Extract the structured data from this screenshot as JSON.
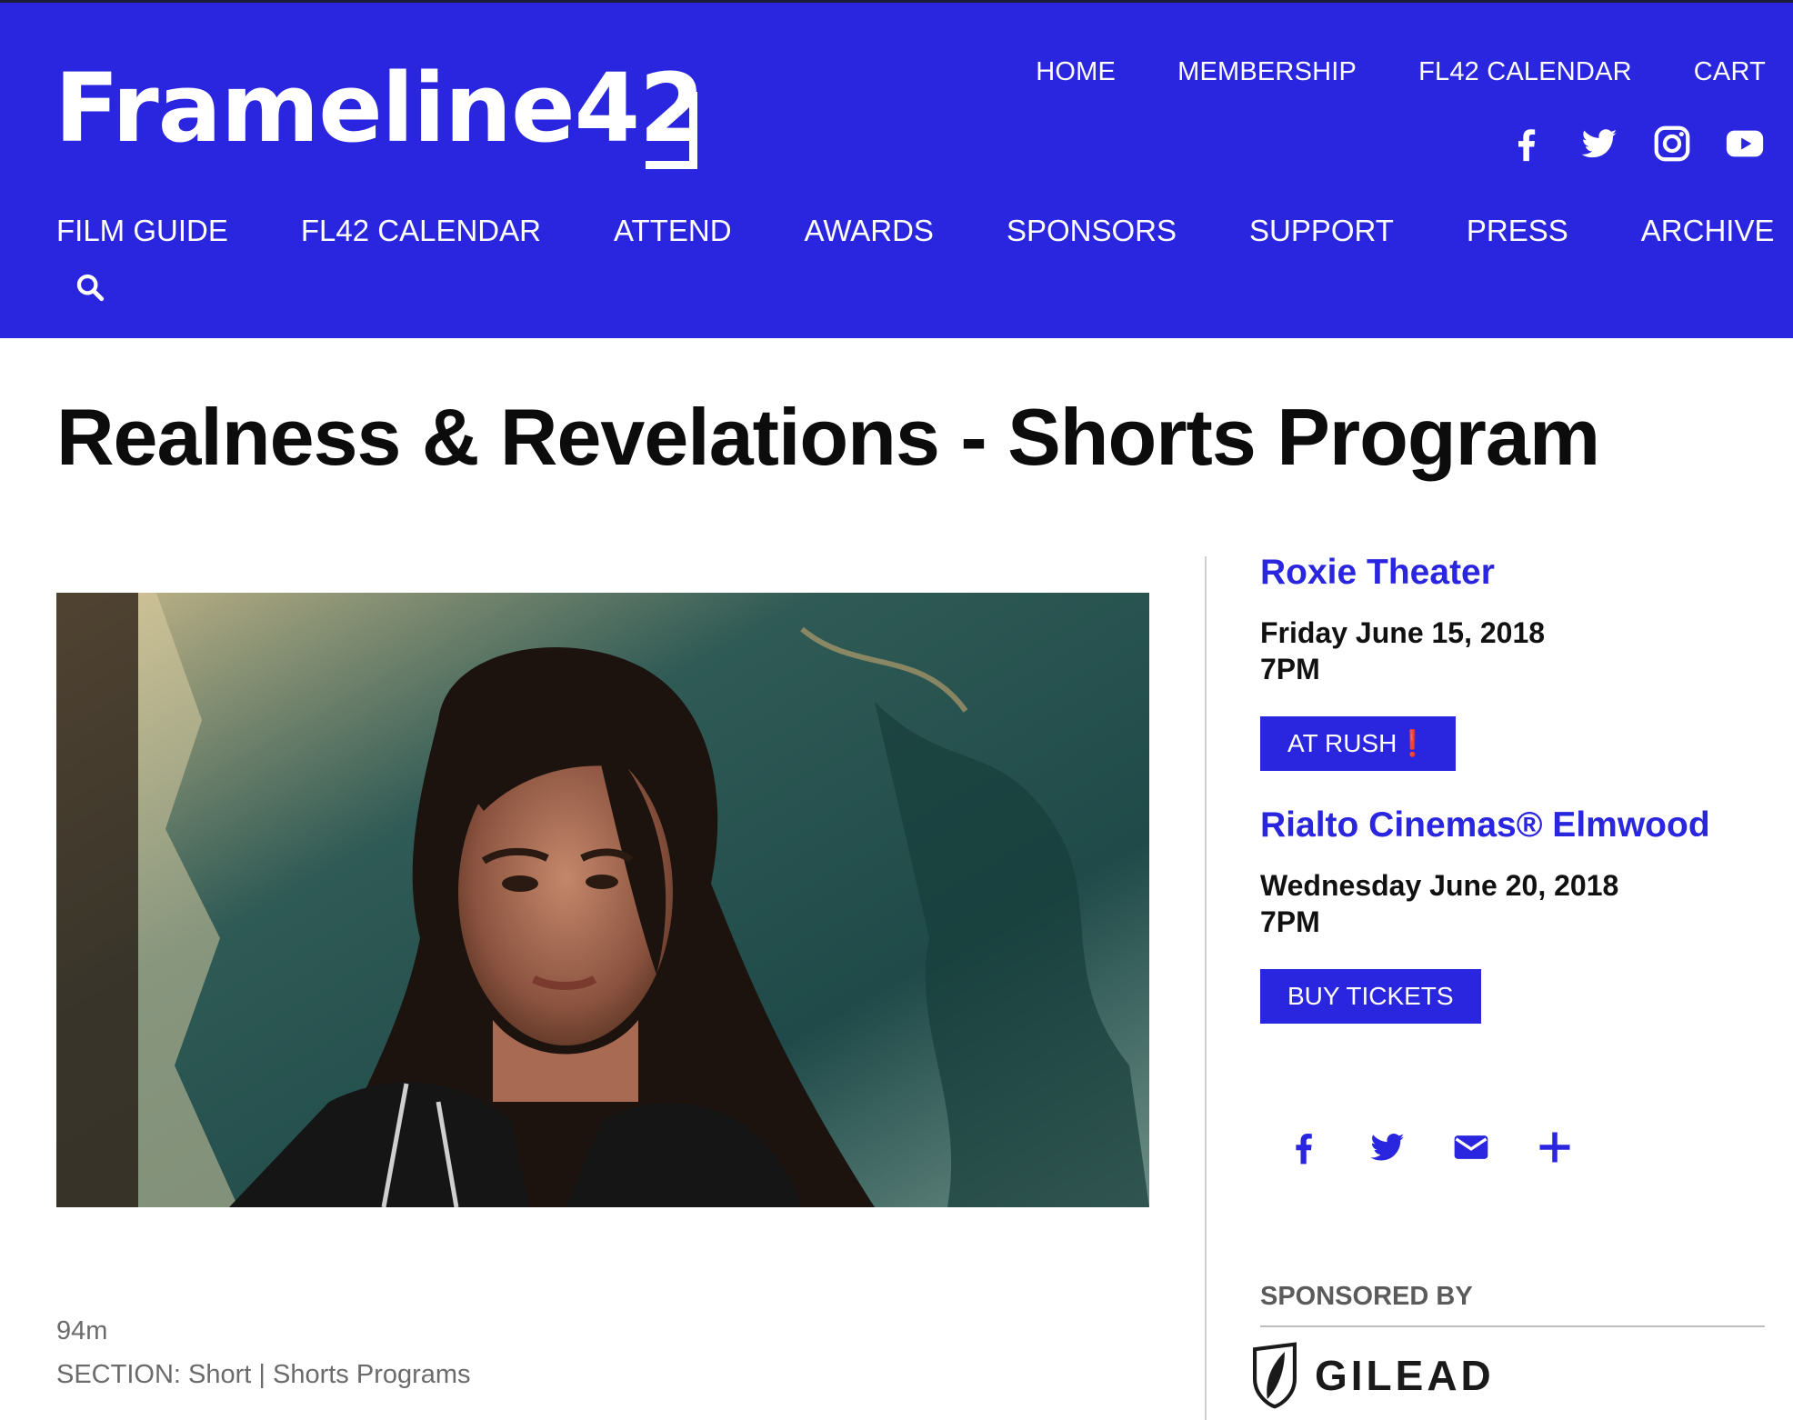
{
  "brand": {
    "logo_text": "Frameline42"
  },
  "top_nav": [
    "HOME",
    "MEMBERSHIP",
    "FL42 CALENDAR",
    "CART"
  ],
  "social_icons": [
    "facebook-icon",
    "twitter-icon",
    "instagram-icon",
    "youtube-icon"
  ],
  "main_nav": [
    "FILM GUIDE",
    "FL42 CALENDAR",
    "ATTEND",
    "AWARDS",
    "SPONSORS",
    "SUPPORT",
    "PRESS",
    "ARCHIVE"
  ],
  "page": {
    "title": "Realness & Revelations - Shorts Program"
  },
  "film": {
    "runtime": "94m",
    "section": "SECTION: Short | Shorts Programs"
  },
  "screenings": [
    {
      "venue": "Roxie Theater",
      "date": "Friday June 15, 2018",
      "time": "7PM",
      "button": "AT RUSH❗"
    },
    {
      "venue": "Rialto Cinemas® Elmwood",
      "date": "Wednesday June 20, 2018",
      "time": "7PM",
      "button": "BUY TICKETS"
    }
  ],
  "share_icons": [
    "facebook-icon",
    "twitter-icon",
    "email-icon",
    "plus-icon"
  ],
  "sponsor": {
    "label": "SPONSORED BY",
    "name": "GILEAD"
  },
  "colors": {
    "brand_blue": "#2a25de",
    "text_dark": "#111111",
    "meta_gray": "#6b6b6b"
  }
}
